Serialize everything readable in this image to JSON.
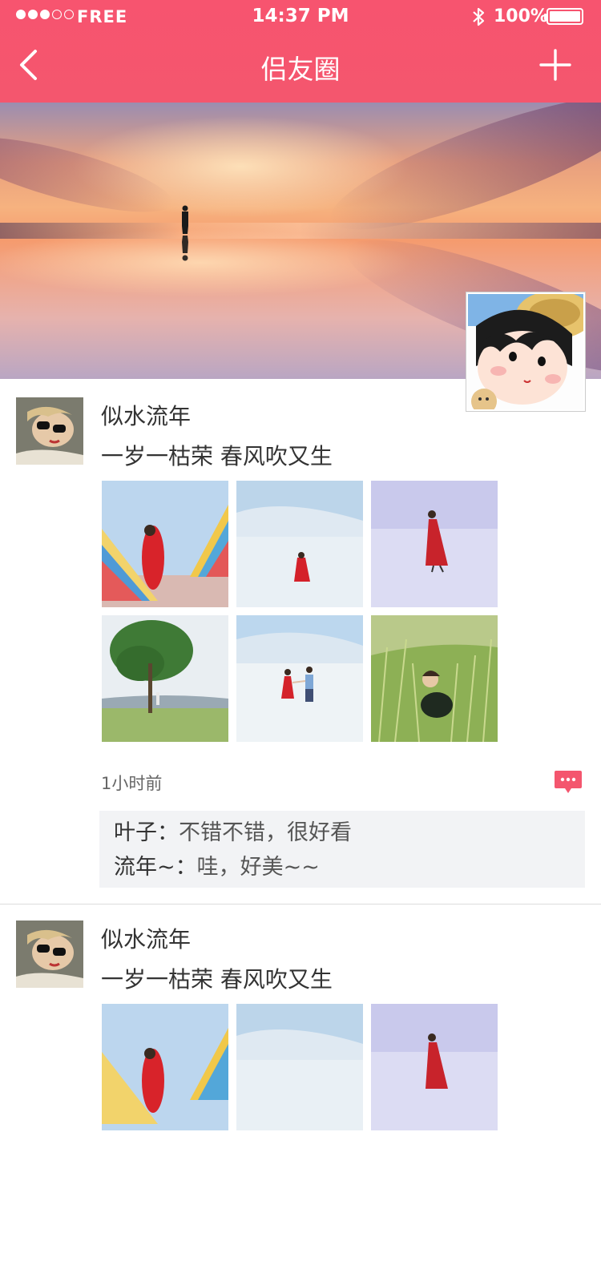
{
  "status_bar": {
    "carrier": "FREE",
    "time": "14:37 PM",
    "battery": "100%"
  },
  "nav": {
    "title": "侣友圈",
    "back_icon": "chevron-left-icon",
    "add_icon": "plus-icon"
  },
  "colors": {
    "accent": "#f4566e",
    "comment_bg": "#f2f3f5",
    "comment_icon": "#f4566e"
  },
  "posts": [
    {
      "name": "似水流年",
      "text": "一岁一枯荣  春风吹又生",
      "time": "1小时前",
      "comments": [
        {
          "user": "叶子：",
          "text": "不错不错，很好看"
        },
        {
          "user": "流年~：",
          "text": "哇，好美~~"
        }
      ]
    },
    {
      "name": "似水流年",
      "text": "一岁一枯荣  春风吹又生"
    }
  ]
}
